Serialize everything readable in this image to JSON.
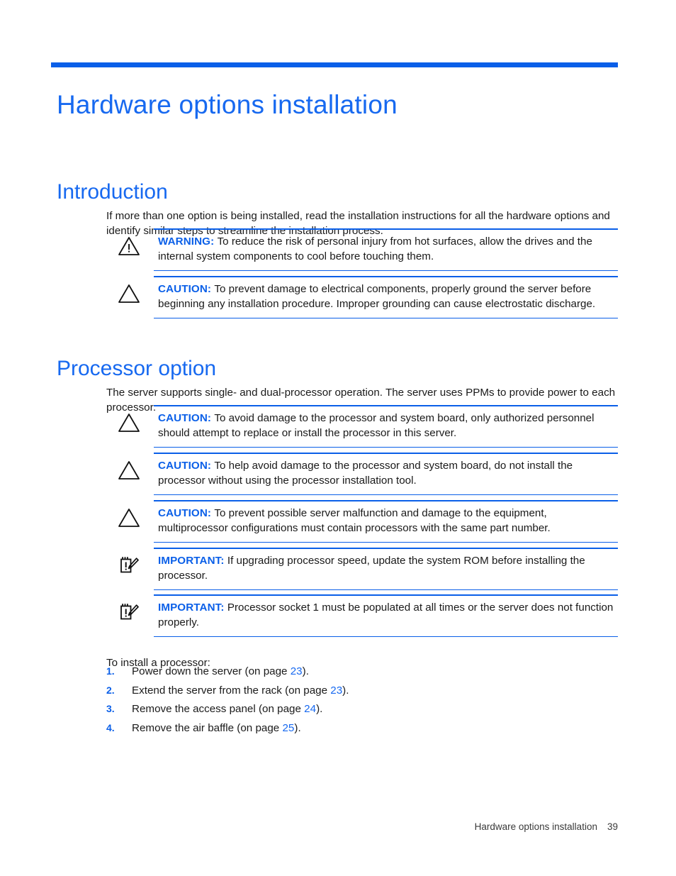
{
  "document": {
    "chapter_title": "Hardware options installation"
  },
  "sections": [
    {
      "heading": "Introduction",
      "paragraph": "If more than one option is being installed, read the installation instructions for all the hardware options and identify similar steps to streamline the installation process."
    },
    {
      "heading": "Processor option",
      "paragraph": "The server supports single- and dual-processor operation. The server uses PPMs to provide power to each processor."
    }
  ],
  "notices": {
    "introduction": [
      {
        "icon": "warning-triangle-exclamation-icon",
        "label": "WARNING:",
        "text": "To reduce the risk of personal injury from hot surfaces, allow the drives and the internal system components to cool before touching them."
      },
      {
        "icon": "caution-triangle-icon",
        "label": "CAUTION:",
        "text": "To prevent damage to electrical components, properly ground the server before beginning any installation procedure. Improper grounding can cause electrostatic discharge."
      }
    ],
    "processor": [
      {
        "icon": "caution-triangle-icon",
        "label": "CAUTION:",
        "text": "To avoid damage to the processor and system board, only authorized personnel should attempt to replace or install the processor in this server."
      },
      {
        "icon": "caution-triangle-icon",
        "label": "CAUTION:",
        "text": "To help avoid damage to the processor and system board, do not install the processor without using the processor installation tool."
      },
      {
        "icon": "caution-triangle-icon",
        "label": "CAUTION:",
        "text": "To prevent possible server malfunction and damage to the equipment, multiprocessor configurations must contain processors with the same part number."
      },
      {
        "icon": "important-note-pencil-icon",
        "label": "IMPORTANT:",
        "text": "If upgrading processor speed, update the system ROM before installing the processor."
      },
      {
        "icon": "important-note-pencil-icon",
        "label": "IMPORTANT:",
        "text": "Processor socket 1 must be populated at all times or the server does not function properly."
      }
    ]
  },
  "procedure": {
    "intro": "To install a processor:",
    "steps": [
      {
        "number": "1.",
        "text_before": "Power down the server (on page ",
        "page": "23",
        "text_after": ")."
      },
      {
        "number": "2.",
        "text_before": "Extend the server from the rack (on page ",
        "page": "23",
        "text_after": ")."
      },
      {
        "number": "3.",
        "text_before": "Remove the access panel (on page ",
        "page": "24",
        "text_after": ")."
      },
      {
        "number": "4.",
        "text_before": "Remove the air baffle (on page ",
        "page": "25",
        "text_after": ")."
      }
    ]
  },
  "footer": {
    "title": "Hardware options installation",
    "page_number": "39"
  },
  "colors": {
    "accent_blue": "#0a5fe8",
    "heading_blue": "#1769f0",
    "body_text": "#1a1a1a"
  }
}
